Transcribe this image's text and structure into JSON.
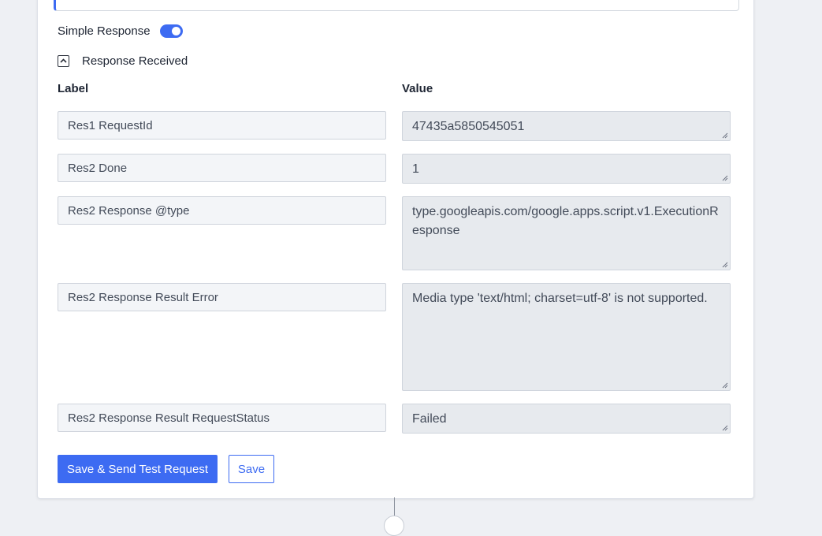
{
  "simple_response": {
    "label": "Simple Response",
    "enabled": true
  },
  "response_received": {
    "label": "Response Received",
    "expanded": true,
    "toggle_icon": "chevron-up-icon"
  },
  "columns": {
    "label": "Label",
    "value": "Value"
  },
  "rows": [
    {
      "label": "Res1 RequestId",
      "value": "47435a5850545051"
    },
    {
      "label": "Res2 Done",
      "value": "1"
    },
    {
      "label": "Res2 Response @type",
      "value": "type.googleapis.com/google.apps.script.v1.ExecutionResponse"
    },
    {
      "label": "Res2 Response Result Error",
      "value": "Media type 'text/html; charset=utf-8' is not supported."
    },
    {
      "label": "Res2 Response Result RequestStatus",
      "value": "Failed"
    }
  ],
  "actions": {
    "save_send": "Save & Send Test Request",
    "save": "Save"
  },
  "colors": {
    "accent": "#3d6bf2",
    "label_field_bg": "#f3f5f8",
    "value_field_bg": "#e7eaee"
  }
}
